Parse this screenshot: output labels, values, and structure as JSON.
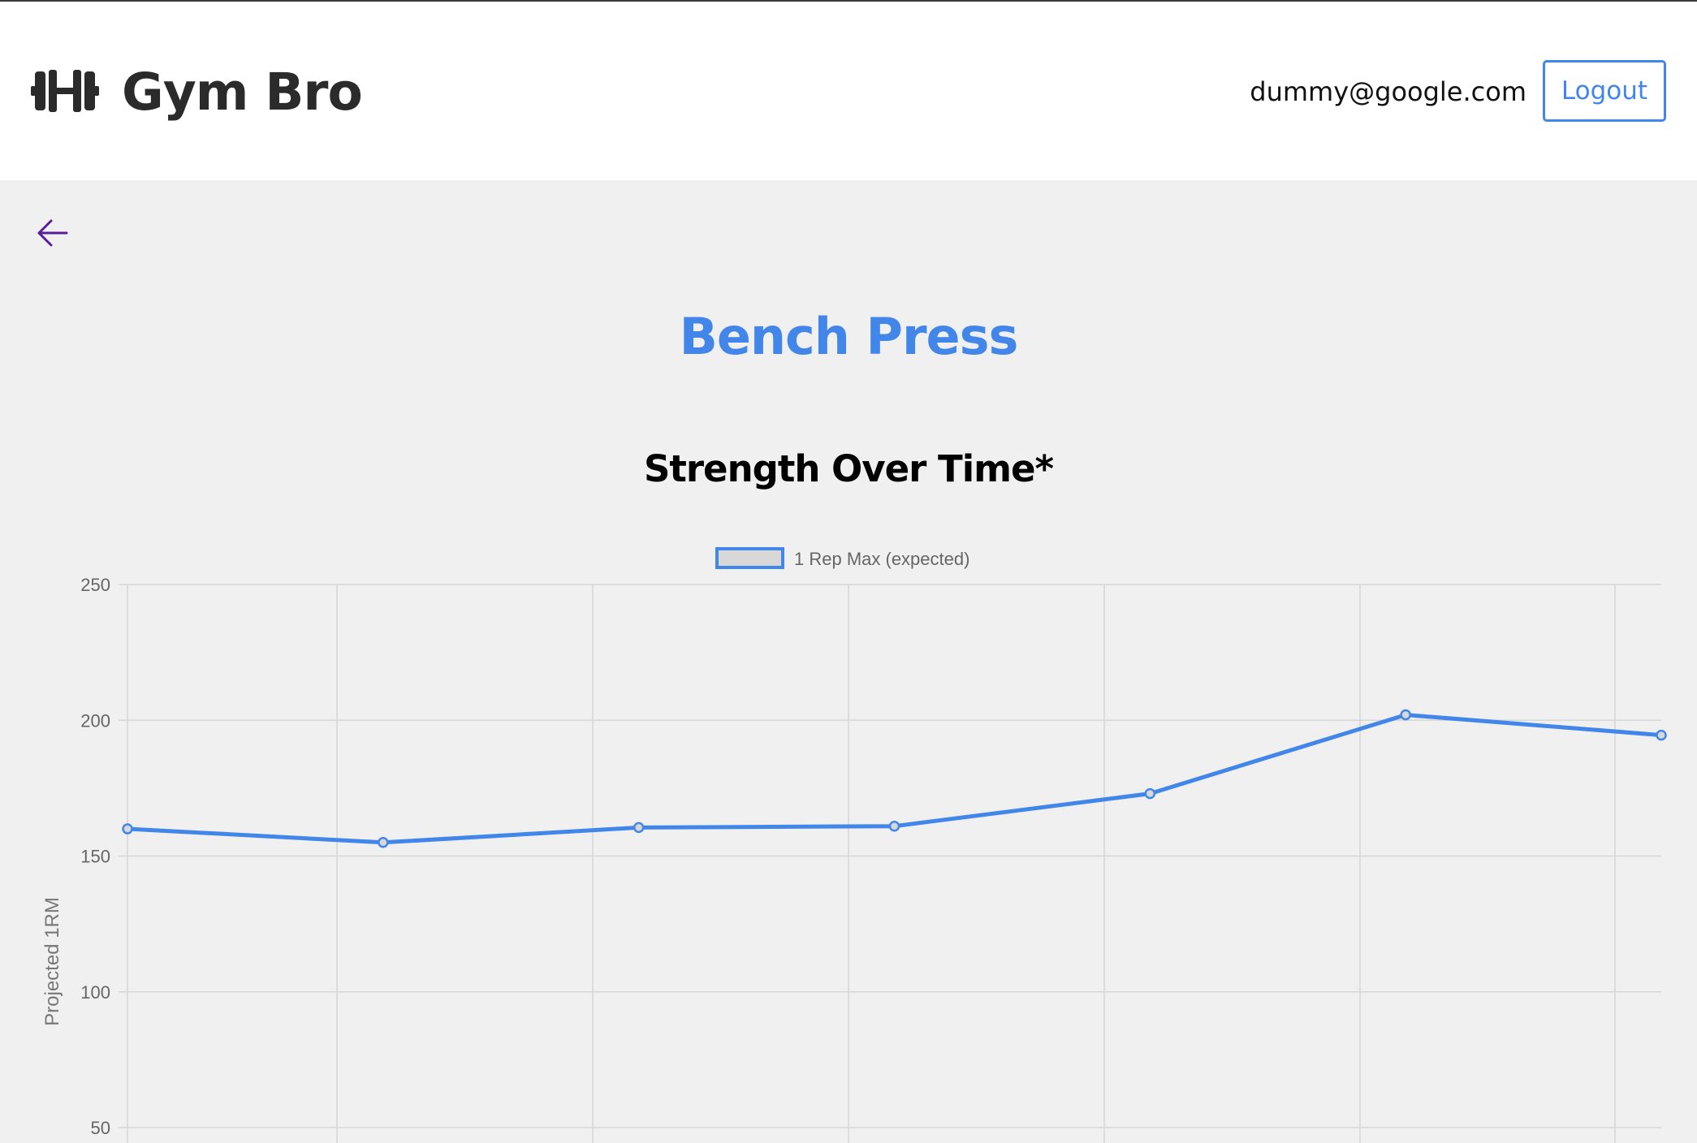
{
  "app": {
    "brand": "Gym Bro",
    "user_email": "dummy@google.com",
    "logout_label": "Logout"
  },
  "page": {
    "title": "Bench Press"
  },
  "colors": {
    "accent": "#4286ea",
    "background": "#f0f0f0",
    "header_bg": "#ffffff",
    "back_arrow": "#5b1d99"
  },
  "icons": {
    "logo": "dumbbell-icon",
    "back": "arrow-left-icon"
  },
  "chart_data": {
    "type": "line",
    "title": "Strength Over Time*",
    "ylabel": "Projected 1RM",
    "xlabel": "",
    "ylim": [
      50,
      250
    ],
    "yticks": [
      250,
      200,
      150,
      100,
      50
    ],
    "grid": true,
    "legend_position": "top-center",
    "series": [
      {
        "name": "1 Rep Max (expected)",
        "color": "#4286ea",
        "values": [
          160,
          155,
          160.5,
          161,
          173,
          202,
          194.5
        ]
      }
    ]
  }
}
